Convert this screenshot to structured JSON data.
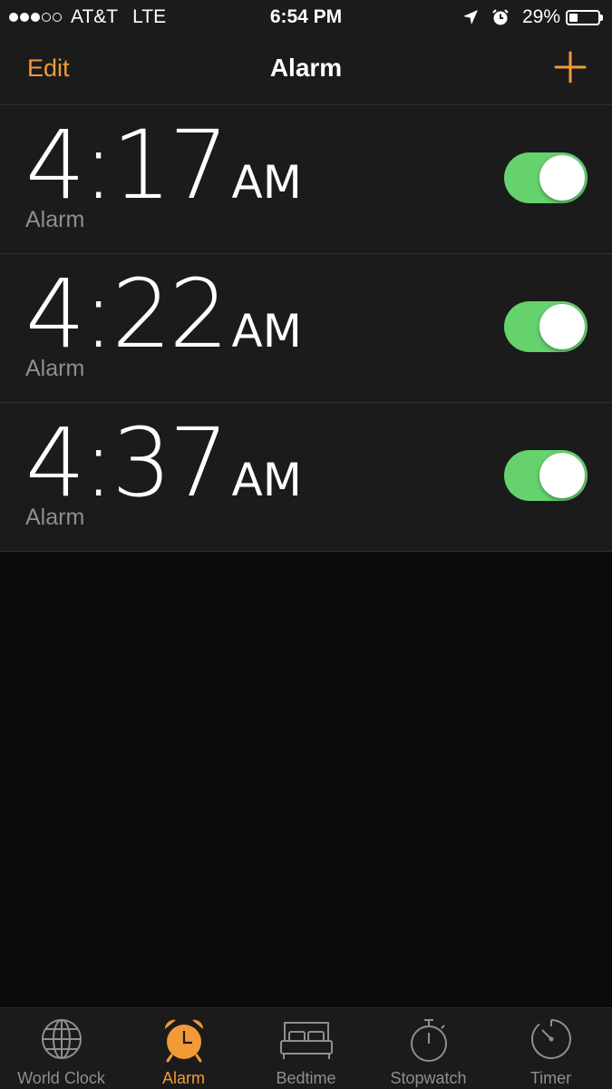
{
  "status": {
    "carrier": "AT&T",
    "network": "LTE",
    "time": "6:54 PM",
    "battery": "29%",
    "battery_level": 0.29,
    "signal_bars": 3,
    "signal_total": 5
  },
  "nav": {
    "edit_label": "Edit",
    "title": "Alarm"
  },
  "alarms": [
    {
      "time": "4:17",
      "ampm": "AM",
      "label": "Alarm",
      "enabled": true
    },
    {
      "time": "4:22",
      "ampm": "AM",
      "label": "Alarm",
      "enabled": true
    },
    {
      "time": "4:37",
      "ampm": "AM",
      "label": "Alarm",
      "enabled": true
    }
  ],
  "tabs": [
    {
      "label": "World Clock",
      "icon": "globe-icon",
      "active": false
    },
    {
      "label": "Alarm",
      "icon": "alarm-clock-icon",
      "active": true
    },
    {
      "label": "Bedtime",
      "icon": "bed-icon",
      "active": false
    },
    {
      "label": "Stopwatch",
      "icon": "stopwatch-icon",
      "active": false
    },
    {
      "label": "Timer",
      "icon": "timer-icon",
      "active": false
    }
  ],
  "colors": {
    "accent": "#f19a38",
    "toggle_on": "#65d26e",
    "bar_background": "#1b1b1c",
    "background": "#0b0b0b",
    "secondary_text": "#8e8e93"
  }
}
